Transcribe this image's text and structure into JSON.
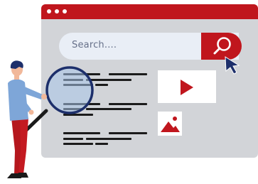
{
  "illustration": {
    "window": {
      "titlebar_dots": [
        "dot",
        "dot",
        "dot"
      ]
    },
    "search": {
      "placeholder": "Search...."
    },
    "results": {
      "count": 3
    },
    "icons": {
      "search": "magnifier-icon",
      "video": "play-icon",
      "image": "mountain-image-icon",
      "cursor": "pointer-cursor-icon"
    },
    "colors": {
      "accent": "#c0161d",
      "window_bg": "#d2d4d8",
      "searchbar_bg": "#e9eef6",
      "text_dark": "#1b1b1b",
      "person_shirt": "#7ea6d8",
      "person_pants": "#b5171d",
      "lens_blue": "#a8c4ea"
    }
  }
}
